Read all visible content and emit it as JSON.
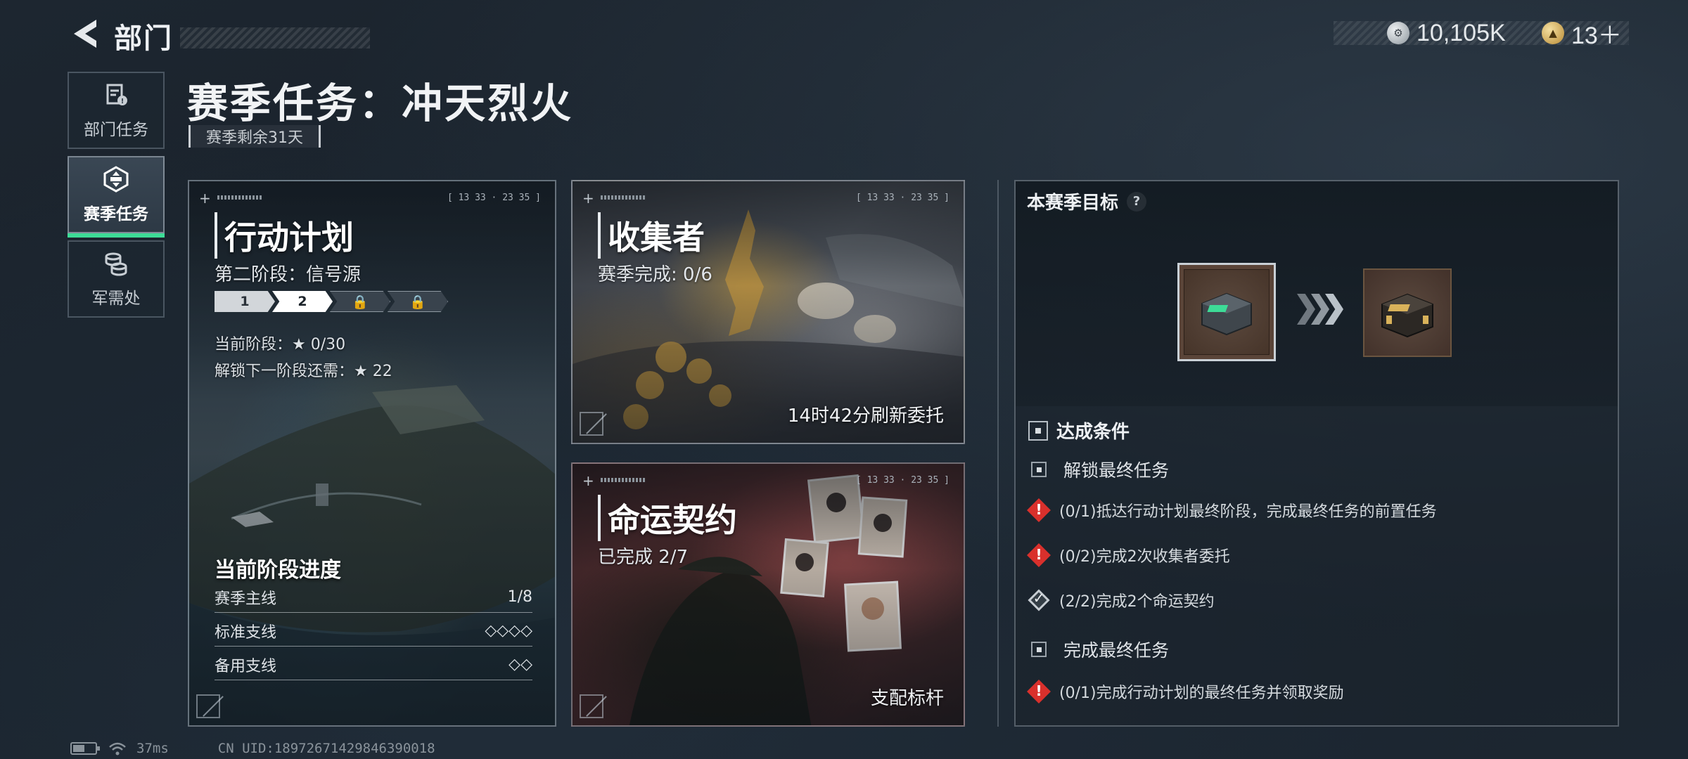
{
  "header": {
    "title": "部门",
    "currency": [
      {
        "icon": "silver-coin-icon",
        "value": "10,105K"
      },
      {
        "icon": "gold-token-icon",
        "value": "13＋"
      }
    ]
  },
  "sidebar": {
    "items": [
      {
        "label": "部门任务",
        "icon": "department-task-icon",
        "active": false
      },
      {
        "label": "赛季任务",
        "icon": "season-task-icon",
        "active": true
      },
      {
        "label": "军需处",
        "icon": "quartermaster-icon",
        "active": false
      }
    ]
  },
  "season": {
    "title": "赛季任务：冲天烈火",
    "remaining": "赛季剩余31天"
  },
  "cards": {
    "ops": {
      "code": "[ 13 33 · 23 35 ]",
      "title": "行动计划",
      "subtitle": "第二阶段：信号源",
      "stages": [
        "1",
        "2",
        "🔒",
        "🔒"
      ],
      "current_stage_label": "当前阶段：★ 0/30",
      "unlock_label": "解锁下一阶段还需：★ 22",
      "progress_title": "当前阶段进度",
      "rows": [
        {
          "label": "赛季主线",
          "value": "1/8"
        },
        {
          "label": "标准支线",
          "value": "◇◇◇◇"
        },
        {
          "label": "备用支线",
          "value": "◇◇"
        }
      ]
    },
    "collector": {
      "code": "[ 13 33 · 23 35 ]",
      "title": "收集者",
      "subtitle": "赛季完成: 0/6",
      "refresh": "14时42分刷新委托"
    },
    "fate": {
      "code": "[ 13 33 · 23 35 ]",
      "title": "命运契约",
      "subtitle": "已完成 2/7",
      "footer": "支配标杆"
    }
  },
  "goal": {
    "title": "本赛季目标",
    "help": "?",
    "conditions_title": "达成条件",
    "groups": [
      {
        "label": "解锁最终任务",
        "items": [
          {
            "status": "warning",
            "text": "(0/1)抵达行动计划最终阶段，完成最终任务的前置任务"
          },
          {
            "status": "warning",
            "text": "(0/2)完成2次收集者委托"
          },
          {
            "status": "done",
            "text": "(2/2)完成2个命运契约"
          }
        ]
      },
      {
        "label": "完成最终任务",
        "items": [
          {
            "status": "warning",
            "text": "(0/1)完成行动计划的最终任务并领取奖励"
          }
        ]
      }
    ]
  },
  "footer": {
    "ping": "37ms",
    "uid": "CN UID:18972671429846390018"
  },
  "colors": {
    "accent_green": "#3ddc97",
    "warning_red": "#d9302c"
  }
}
